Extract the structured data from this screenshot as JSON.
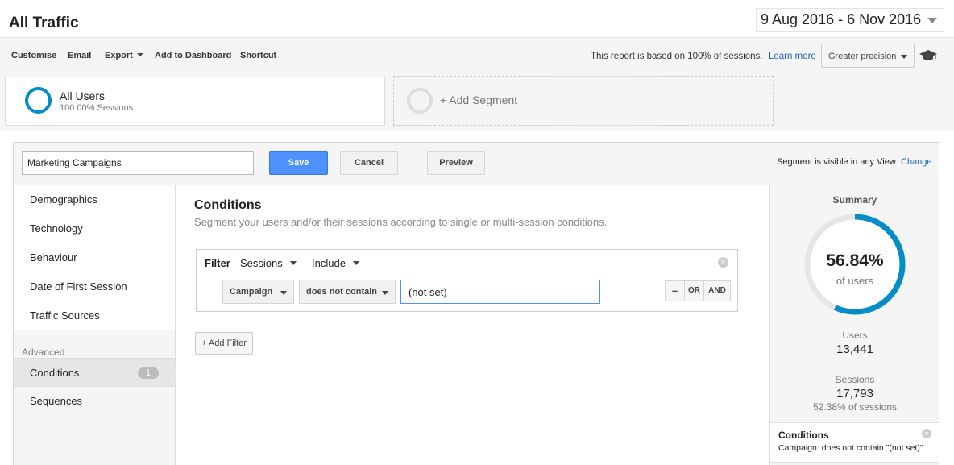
{
  "header": {
    "title": "All Traffic",
    "date_range": "9 Aug 2016 - 6 Nov 2016"
  },
  "toolbar": {
    "customise": "Customise",
    "email": "Email",
    "export": "Export",
    "add_to_dashboard": "Add to Dashboard",
    "shortcut": "Shortcut",
    "report_note": "This report is based on 100% of sessions.",
    "learn_more": "Learn more",
    "precision": "Greater precision",
    "precision_icon": "graduation-cap-icon"
  },
  "segments": {
    "all_users_name": "All Users",
    "all_users_sub": "100.00% Sessions",
    "add_segment": "+ Add Segment",
    "ring_color": "#058dc7"
  },
  "editor": {
    "segment_name_value": "Marketing Campaigns",
    "save": "Save",
    "cancel": "Cancel",
    "preview": "Preview",
    "visibility_note": "Segment is visible in any View",
    "change": "Change"
  },
  "nav": {
    "items": [
      {
        "label": "Demographics"
      },
      {
        "label": "Technology"
      },
      {
        "label": "Behaviour"
      },
      {
        "label": "Date of First Session"
      },
      {
        "label": "Traffic Sources"
      }
    ],
    "advanced_label": "Advanced",
    "conditions": "Conditions",
    "conditions_badge": "1",
    "sequences": "Sequences"
  },
  "conditions": {
    "title": "Conditions",
    "description": "Segment your users and/or their sessions according to single or multi-session conditions.",
    "filter_label": "Filter",
    "scope": "Sessions",
    "mode": "Include",
    "dimension": "Campaign",
    "operator": "does not contain",
    "value": "(not set)",
    "logic_minus": "–",
    "logic_or": "OR",
    "logic_and": "AND",
    "add_filter": "+ Add Filter"
  },
  "summary": {
    "title": "Summary",
    "percent": "56.84%",
    "percent_value": 0.5684,
    "percent_sub": "of users",
    "users_label": "Users",
    "users_value": "13,441",
    "sessions_label": "Sessions",
    "sessions_value": "17,793",
    "sessions_pct": "52.38% of sessions",
    "conditions_title": "Conditions",
    "conditions_desc": "Campaign: does not contain \"(not set)\"",
    "gauge_color": "#058dc7",
    "gauge_track": "#e6e6e6"
  }
}
